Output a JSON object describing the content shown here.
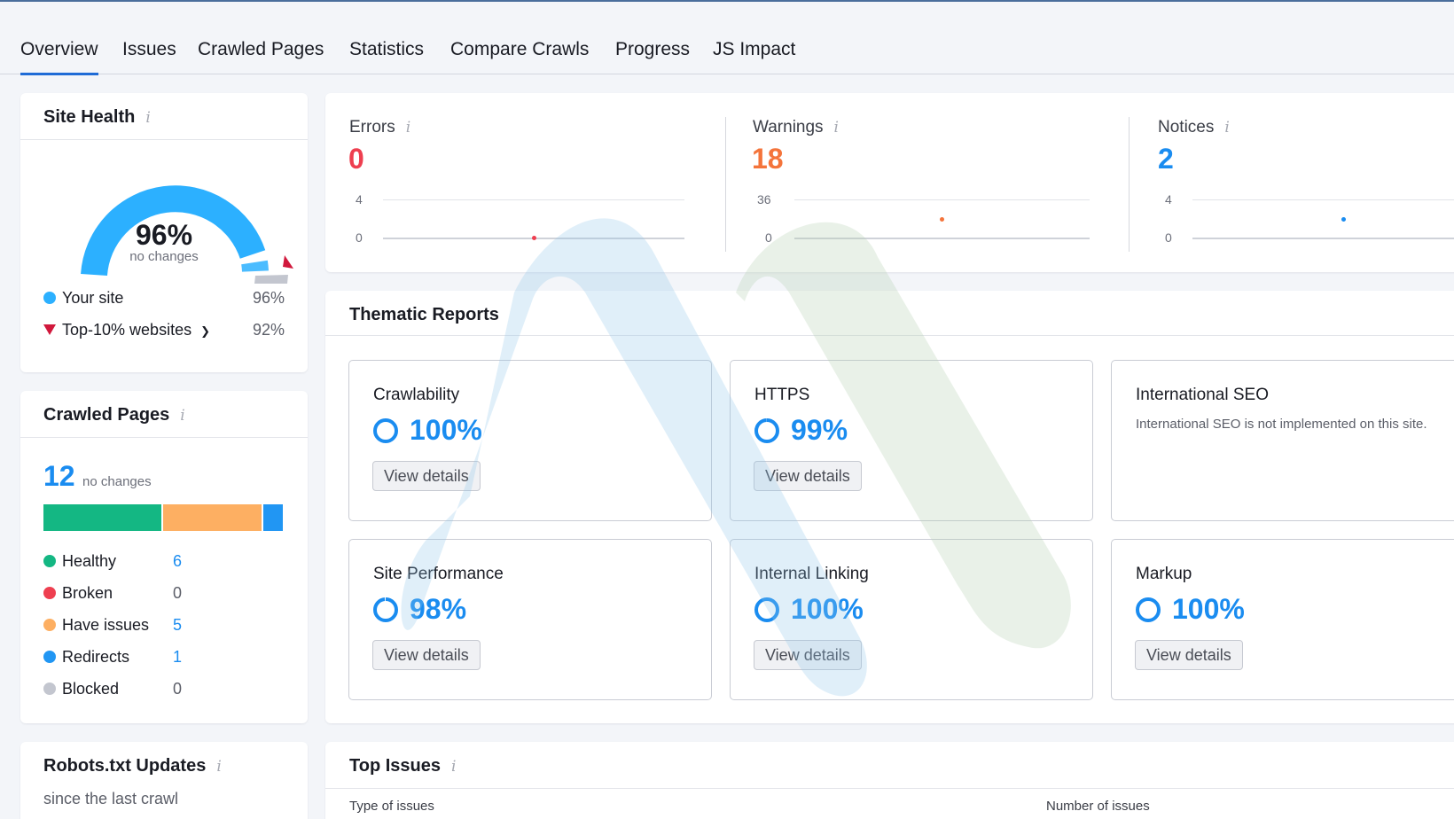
{
  "tabs": [
    "Overview",
    "Issues",
    "Crawled Pages",
    "Statistics",
    "Compare Crawls",
    "Progress",
    "JS Impact"
  ],
  "site_health": {
    "title": "Site Health",
    "info": "i",
    "percent": "96%",
    "percent_value": 96,
    "change": "no changes",
    "legend": [
      {
        "label": "Your site",
        "value": "96%"
      },
      {
        "label": "Top-10% websites",
        "value": "92%"
      }
    ]
  },
  "crawled_pages": {
    "title": "Crawled Pages",
    "info": "i",
    "count": "12",
    "change": "no changes",
    "bar": {
      "healthy": 6,
      "have_issues": 5,
      "redirects": 1
    },
    "legend": [
      {
        "label": "Healthy",
        "value": "6",
        "color": "#14b783"
      },
      {
        "label": "Broken",
        "value": "0",
        "color": "#ee3f50"
      },
      {
        "label": "Have issues",
        "value": "5",
        "color": "#fdaf62"
      },
      {
        "label": "Redirects",
        "value": "1",
        "color": "#2196f3"
      },
      {
        "label": "Blocked",
        "value": "0",
        "color": "#c3c6cf"
      }
    ]
  },
  "robots": {
    "title": "Robots.txt Updates",
    "info": "i",
    "subtitle": "since the last crawl"
  },
  "metrics": [
    {
      "label": "Errors",
      "info": "i",
      "value": "0",
      "color": "#ee3f50",
      "axis_top": "4",
      "axis_bottom": "0"
    },
    {
      "label": "Warnings",
      "info": "i",
      "value": "18",
      "color": "#f4743b",
      "axis_top": "36",
      "axis_bottom": "0"
    },
    {
      "label": "Notices",
      "info": "i",
      "value": "2",
      "color": "#1a8cf0",
      "axis_top": "4",
      "axis_bottom": "0"
    }
  ],
  "thematic": {
    "title": "Thematic Reports",
    "reports": [
      {
        "name": "Crawlability",
        "pct": "100%",
        "value": 100,
        "button": "View details"
      },
      {
        "name": "HTTPS",
        "pct": "99%",
        "value": 99,
        "button": "View details"
      },
      {
        "name": "International SEO",
        "note": "International SEO is not implemented on this site."
      },
      {
        "name": "Site Performance",
        "pct": "98%",
        "value": 98,
        "button": "View details"
      },
      {
        "name": "Internal Linking",
        "pct": "100%",
        "value": 100,
        "button": "View details"
      },
      {
        "name": "Markup",
        "pct": "100%",
        "value": 100,
        "button": "View details"
      }
    ]
  },
  "top_issues": {
    "title": "Top Issues",
    "info": "i",
    "col_type": "Type of issues",
    "col_count": "Number of issues"
  },
  "colors": {
    "accent": "#1f6bd6",
    "gauge": "#2cb0ff",
    "error": "#ee3f50",
    "warning": "#f4743b",
    "notice": "#1a8cf0"
  }
}
